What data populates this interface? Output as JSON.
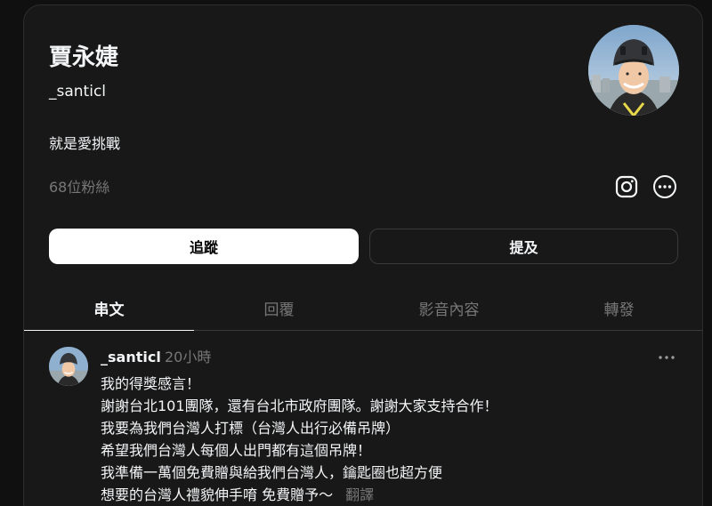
{
  "profile": {
    "display_name": "賈永婕",
    "handle": "_santicl",
    "bio": "就是愛挑戰",
    "followers": "68位粉絲"
  },
  "buttons": {
    "follow_label": "追蹤",
    "mention_label": "提及"
  },
  "icons": {
    "instagram": "instagram-icon",
    "more": "more-circle-icon",
    "post_menu": "ellipsis-icon"
  },
  "tabs": [
    {
      "label": "串文",
      "active": true
    },
    {
      "label": "回覆",
      "active": false
    },
    {
      "label": "影音內容",
      "active": false
    },
    {
      "label": "轉發",
      "active": false
    }
  ],
  "post": {
    "author": "_santicl",
    "time": "20小時",
    "lines": [
      "我的得獎感言！",
      "謝謝台北101團隊，還有台北市政府團隊。謝謝大家支持合作！",
      "我要為我們台灣人打標（台灣人出行必備吊牌）",
      "希望我們台灣人每個人出門都有這個吊牌！",
      "我準備一萬個免費贈與給我們台灣人，鑰匙圈也超方便",
      "想要的台灣人禮貌伸手唷 免費贈予～"
    ],
    "translate_label": "翻譯"
  },
  "colors": {
    "background": "#101010",
    "panel": "#181818",
    "text_primary": "#f3f5f7",
    "text_secondary": "#777777",
    "border": "#3a3a3a",
    "follow_button_bg": "#ffffff"
  }
}
